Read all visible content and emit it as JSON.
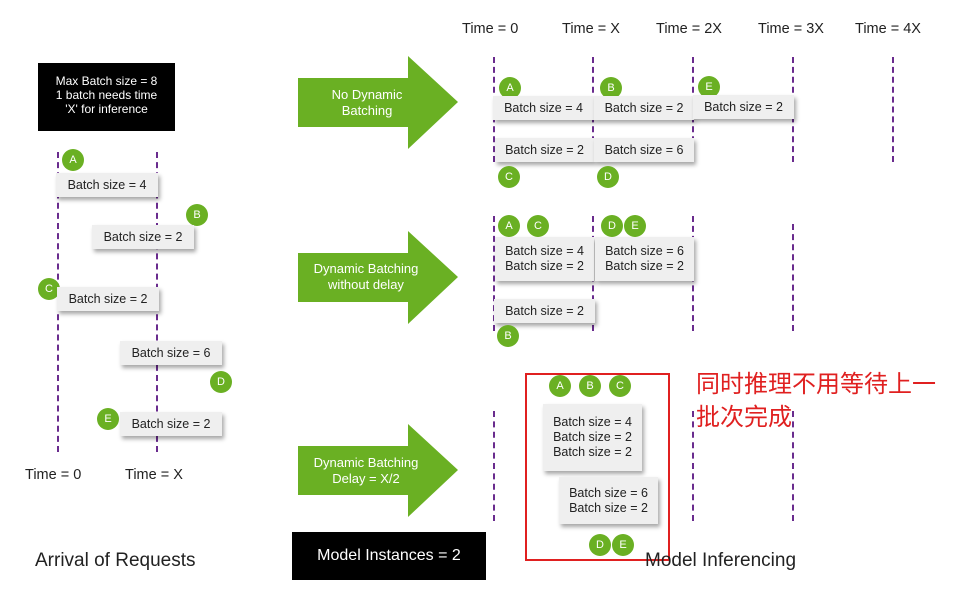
{
  "info_box": [
    "Max Batch size = 8",
    "1 batch needs time",
    "'X' for inference"
  ],
  "arrival": {
    "time_left": "Time = 0",
    "time_right": "Time = X",
    "caption": "Arrival of Requests",
    "boxes": [
      "Batch size = 4",
      "Batch size = 2",
      "Batch size = 2",
      "Batch size = 6",
      "Batch size = 2"
    ],
    "badges": [
      "A",
      "B",
      "C",
      "D",
      "E"
    ]
  },
  "top_times": [
    "Time = 0",
    "Time = X",
    "Time = 2X",
    "Time = 3X",
    "Time = 4X"
  ],
  "arrows": [
    "No Dynamic Batching",
    "Dynamic Batching without delay",
    "Dynamic Batching Delay = X/2"
  ],
  "row1": {
    "boxes": [
      "Batch size = 4",
      "Batch size = 2",
      "Batch size = 2",
      "Batch size = 2",
      "Batch size = 6"
    ],
    "badges": [
      "A",
      "B",
      "E",
      "C",
      "D"
    ]
  },
  "row2": {
    "box1": [
      "Batch size = 4",
      "Batch size = 2"
    ],
    "box2": [
      "Batch size = 6",
      "Batch size = 2"
    ],
    "box3": "Batch size = 2",
    "badges": [
      "A",
      "C",
      "D",
      "E",
      "B"
    ]
  },
  "row3": {
    "box1": [
      "Batch size = 4",
      "Batch size = 2",
      "Batch size = 2"
    ],
    "box2": [
      "Batch size = 6",
      "Batch size = 2"
    ],
    "badges": [
      "A",
      "B",
      "C",
      "D",
      "E"
    ]
  },
  "annotation": "同时推理不用等待上一批次完成",
  "model_instances": "Model Instances = 2",
  "model_inferencing": "Model Inferencing",
  "colors": {
    "green": "#6ab023",
    "purple_dash": "#6a2c8e",
    "annotation_red": "#e02020"
  }
}
